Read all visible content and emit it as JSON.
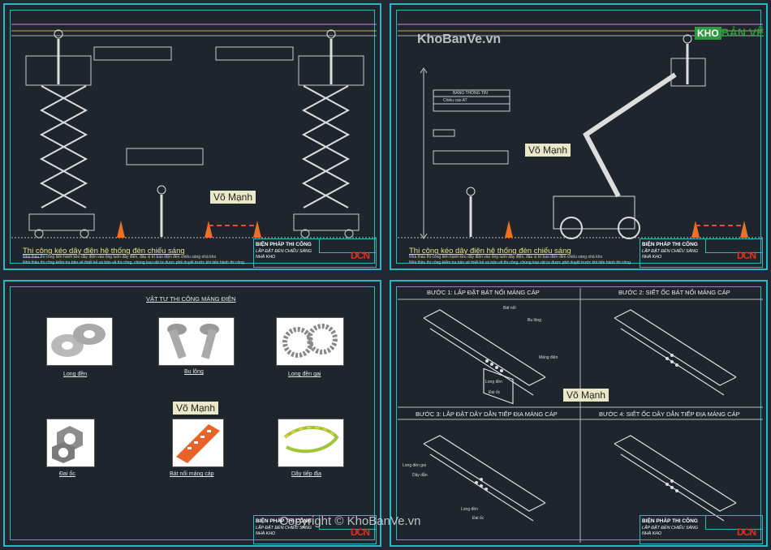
{
  "panel1": {
    "title": "Thi công kéo dây điện hệ thống đèn chiếu sáng",
    "notes": [
      "Nhà thầu thi công tiến hành kéo dây điện vào ống luồn dây điện, đấu vị trí bao điện đèn chiếu sáng nhà kho",
      "Nhà thầu thi công kiểm tra bản vẽ thiết kế và bản vẽ thi công, chúng loại vật tư được phê duyệt trước khi tiến hành thi công"
    ],
    "watermark": "Võ Mạnh"
  },
  "panel2": {
    "title": "Thi công kéo dây điện hệ thống đèn chiếu sáng",
    "notes": [
      "Nhà thầu thi công tiến hành kéo dây điện vào ống luồn dây điện, đấu vị trí bao điện đèn chiếu sáng nhà kho",
      "Nhà thầu thi công kiểm tra bản vẽ thiết kế và bản vẽ thi công, chúng loại vật tư được phê duyệt trước khi tiến hành thi công"
    ],
    "watermark": "Võ Mạnh",
    "table_title": "BẢNG THÔNG TIN",
    "table_row": "Chiều cao AT"
  },
  "panel3": {
    "title": "VẬT TƯ THI CÔNG MÁNG ĐIỆN",
    "items": [
      "Long đền",
      "Bu lông",
      "Long đền gai",
      "Đai ốc",
      "Bát nối máng cáp",
      "Dây tiếp địa"
    ],
    "watermark": "Võ Mạnh"
  },
  "panel4": {
    "steps": [
      "BƯỚC 1: LẮP ĐẶT BÁT NỐI MÁNG CÁP",
      "BƯỚC 2: SIẾT ỐC BÁT NỐI MÁNG CÁP",
      "BƯỚC 3: LẮP ĐẶT DÂY DẪN TIẾP ĐỊA MÁNG CÁP",
      "BƯỚC 4: SIẾT ỐC DÂY DẪN TIẾP ĐỊA MÁNG CÁP"
    ],
    "labels1": [
      "Bát nối",
      "Bu lông",
      "Máng điện",
      "Long đền",
      "Đai ốc"
    ],
    "labels3": [
      "Long đền gai",
      "Dây dẫn",
      "Long đền",
      "Đai ốc"
    ],
    "watermark": "Võ Mạnh"
  },
  "titleblock": {
    "title": "BIỆN PHÁP THI CÔNG",
    "sub": "LẮP ĐẶT ĐÈN CHIẾU SÁNG",
    "place": "NHÀ KHO",
    "logo": "DCN"
  },
  "brand": {
    "site": "KhoBanVe.vn",
    "logo_k": "KHO",
    "logo_rest": "BẢN VẼ",
    "copyright": "Copyright © KhoBanVe.vn"
  },
  "colors": {
    "border": "#2bb7c4",
    "accent": "#e84c3d",
    "title": "#e9e37a"
  }
}
